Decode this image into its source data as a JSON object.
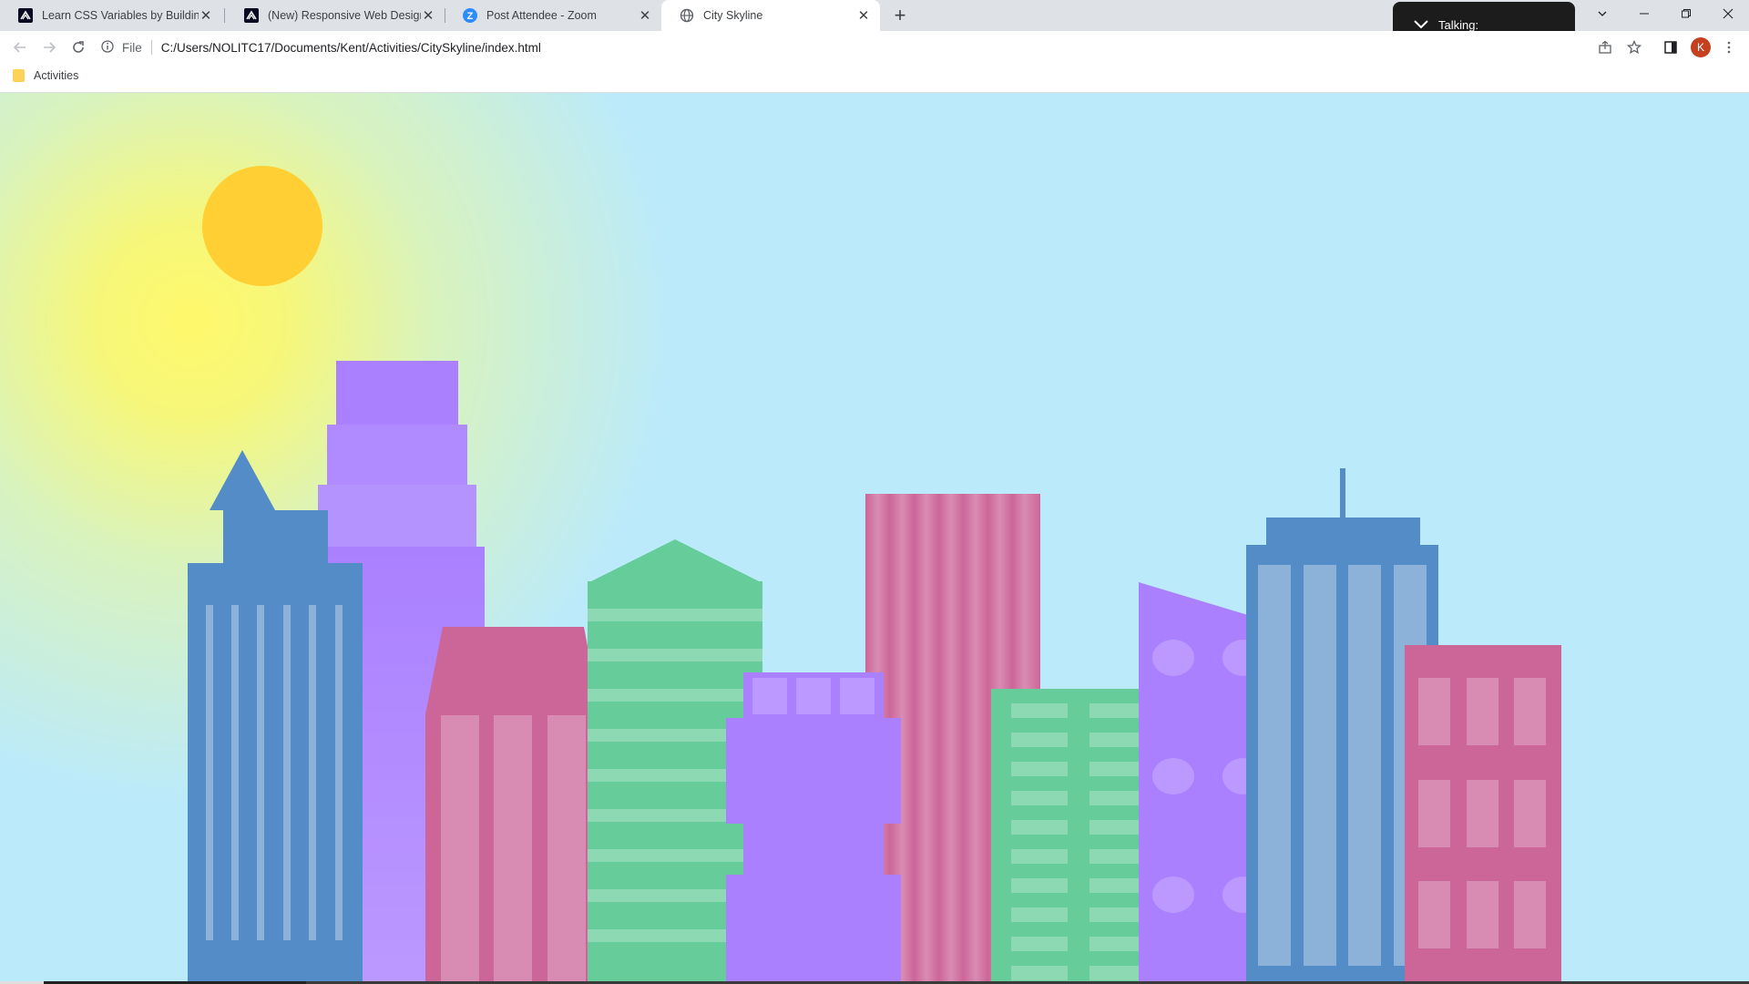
{
  "browser": {
    "tabs": [
      {
        "title": "Learn CSS Variables by Building a",
        "favicon": "freecodecamp-icon",
        "active": false
      },
      {
        "title": "(New) Responsive Web Design Ce",
        "favicon": "freecodecamp-icon",
        "active": false
      },
      {
        "title": "Post Attendee - Zoom",
        "favicon": "zoom-icon",
        "active": false
      },
      {
        "title": "City Skyline",
        "favicon": "globe-icon",
        "active": true
      }
    ],
    "new_tab_glyph": "+",
    "address_scheme_label": "File",
    "address": "C:/Users/NOLITC17/Documents/Kent/Activities/CitySkyline/index.html",
    "profile_initial": "K",
    "bookmarks": [
      {
        "label": "Activities",
        "icon": "folder-icon"
      }
    ]
  },
  "zoom_overlay": {
    "label": "Talking:"
  },
  "page": {
    "title": "City Skyline",
    "colors": {
      "sky": "#bbeafb",
      "sun": "#ffcf33",
      "sun_glow": "#fff86b",
      "building_blue": "#538cc6",
      "window_blue": "#8cb2d9",
      "building_purple": "#aa80ff",
      "window_purple": "#bb99ff",
      "building_pink": "#cc6699",
      "window_pink": "#d98cb3",
      "building_green": "#66cc99",
      "window_green": "#8cd9b3"
    }
  }
}
